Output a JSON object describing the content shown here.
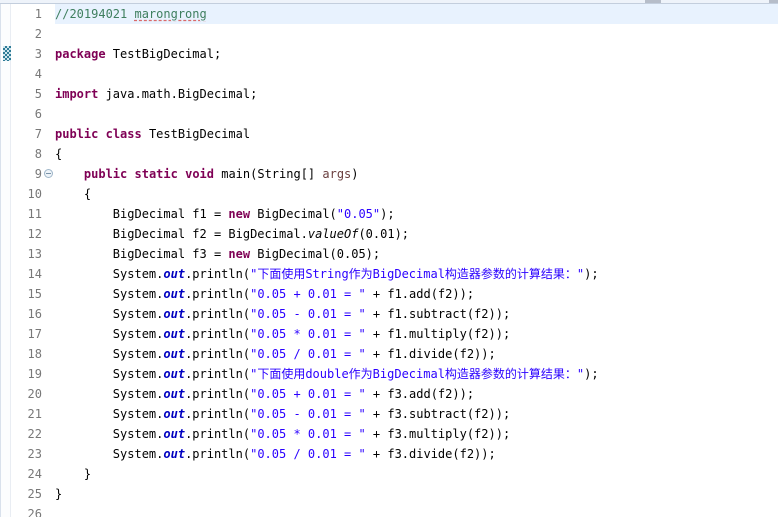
{
  "editor": {
    "language": "java",
    "current_line": 1,
    "fold_line": 9,
    "marker_line": 3,
    "visible_line_count": 26,
    "colors": {
      "keyword": "#7f0055",
      "string": "#2a00ff",
      "comment": "#3f7f5f",
      "static_field": "#0000c0",
      "static_method": "#000000",
      "parameter": "#6a3e3e",
      "plain": "#000000",
      "line_number": "#787878",
      "current_line_background": "#e8f2fe",
      "task_marker": "#2e7b96",
      "spell_underline": "#d96a6a"
    },
    "lines": [
      {
        "n": 1,
        "segs": [
          [
            "com",
            "//20194021 "
          ],
          [
            "comu",
            "marongrong"
          ]
        ]
      },
      {
        "n": 2,
        "segs": []
      },
      {
        "n": 3,
        "segs": [
          [
            "kw",
            "package"
          ],
          [
            "pl",
            " TestBigDecimal;"
          ]
        ]
      },
      {
        "n": 4,
        "segs": []
      },
      {
        "n": 5,
        "segs": [
          [
            "kw",
            "import"
          ],
          [
            "pl",
            " java.math.BigDecimal;"
          ]
        ]
      },
      {
        "n": 6,
        "segs": []
      },
      {
        "n": 7,
        "segs": [
          [
            "kw",
            "public"
          ],
          [
            "pl",
            " "
          ],
          [
            "kw",
            "class"
          ],
          [
            "pl",
            " TestBigDecimal"
          ]
        ]
      },
      {
        "n": 8,
        "segs": [
          [
            "pl",
            "{"
          ]
        ]
      },
      {
        "n": 9,
        "segs": [
          [
            "pl",
            "    "
          ],
          [
            "kw",
            "public"
          ],
          [
            "pl",
            " "
          ],
          [
            "kw",
            "static"
          ],
          [
            "pl",
            " "
          ],
          [
            "kw",
            "void"
          ],
          [
            "pl",
            " main(String[] "
          ],
          [
            "par",
            "args"
          ],
          [
            "pl",
            ")"
          ]
        ]
      },
      {
        "n": 10,
        "segs": [
          [
            "pl",
            "    {"
          ]
        ]
      },
      {
        "n": 11,
        "segs": [
          [
            "pl",
            "        BigDecimal f1 = "
          ],
          [
            "kw",
            "new"
          ],
          [
            "pl",
            " BigDecimal("
          ],
          [
            "str",
            "\"0.05\""
          ],
          [
            "pl",
            ");"
          ]
        ]
      },
      {
        "n": 12,
        "segs": [
          [
            "pl",
            "        BigDecimal f2 = BigDecimal."
          ],
          [
            "sm",
            "valueOf"
          ],
          [
            "pl",
            "(0.01);"
          ]
        ]
      },
      {
        "n": 13,
        "segs": [
          [
            "pl",
            "        BigDecimal f3 = "
          ],
          [
            "kw",
            "new"
          ],
          [
            "pl",
            " BigDecimal(0.05);"
          ]
        ]
      },
      {
        "n": 14,
        "segs": [
          [
            "pl",
            "        System."
          ],
          [
            "sf",
            "out"
          ],
          [
            "pl",
            ".println("
          ],
          [
            "str",
            "\"下面使用String作为BigDecimal构造器参数的计算结果：\""
          ],
          [
            "pl",
            ");"
          ]
        ]
      },
      {
        "n": 15,
        "segs": [
          [
            "pl",
            "        System."
          ],
          [
            "sf",
            "out"
          ],
          [
            "pl",
            ".println("
          ],
          [
            "str",
            "\"0.05 + 0.01 = \""
          ],
          [
            "pl",
            " + f1.add(f2));"
          ]
        ]
      },
      {
        "n": 16,
        "segs": [
          [
            "pl",
            "        System."
          ],
          [
            "sf",
            "out"
          ],
          [
            "pl",
            ".println("
          ],
          [
            "str",
            "\"0.05 - 0.01 = \""
          ],
          [
            "pl",
            " + f1.subtract(f2));"
          ]
        ]
      },
      {
        "n": 17,
        "segs": [
          [
            "pl",
            "        System."
          ],
          [
            "sf",
            "out"
          ],
          [
            "pl",
            ".println("
          ],
          [
            "str",
            "\"0.05 * 0.01 = \""
          ],
          [
            "pl",
            " + f1.multiply(f2));"
          ]
        ]
      },
      {
        "n": 18,
        "segs": [
          [
            "pl",
            "        System."
          ],
          [
            "sf",
            "out"
          ],
          [
            "pl",
            ".println("
          ],
          [
            "str",
            "\"0.05 / 0.01 = \""
          ],
          [
            "pl",
            " + f1.divide(f2));"
          ]
        ]
      },
      {
        "n": 19,
        "segs": [
          [
            "pl",
            "        System."
          ],
          [
            "sf",
            "out"
          ],
          [
            "pl",
            ".println("
          ],
          [
            "str",
            "\"下面使用double作为BigDecimal构造器参数的计算结果：\""
          ],
          [
            "pl",
            ");"
          ]
        ]
      },
      {
        "n": 20,
        "segs": [
          [
            "pl",
            "        System."
          ],
          [
            "sf",
            "out"
          ],
          [
            "pl",
            ".println("
          ],
          [
            "str",
            "\"0.05 + 0.01 = \""
          ],
          [
            "pl",
            " + f3.add(f2));"
          ]
        ]
      },
      {
        "n": 21,
        "segs": [
          [
            "pl",
            "        System."
          ],
          [
            "sf",
            "out"
          ],
          [
            "pl",
            ".println("
          ],
          [
            "str",
            "\"0.05 - 0.01 = \""
          ],
          [
            "pl",
            " + f3.subtract(f2));"
          ]
        ]
      },
      {
        "n": 22,
        "segs": [
          [
            "pl",
            "        System."
          ],
          [
            "sf",
            "out"
          ],
          [
            "pl",
            ".println("
          ],
          [
            "str",
            "\"0.05 * 0.01 = \""
          ],
          [
            "pl",
            " + f3.multiply(f2));"
          ]
        ]
      },
      {
        "n": 23,
        "segs": [
          [
            "pl",
            "        System."
          ],
          [
            "sf",
            "out"
          ],
          [
            "pl",
            ".println("
          ],
          [
            "str",
            "\"0.05 / 0.01 = \""
          ],
          [
            "pl",
            " + f3.divide(f2));"
          ]
        ]
      },
      {
        "n": 24,
        "segs": [
          [
            "pl",
            "    }"
          ]
        ]
      },
      {
        "n": 25,
        "segs": [
          [
            "pl",
            "}"
          ]
        ]
      },
      {
        "n": 26,
        "segs": []
      }
    ]
  }
}
